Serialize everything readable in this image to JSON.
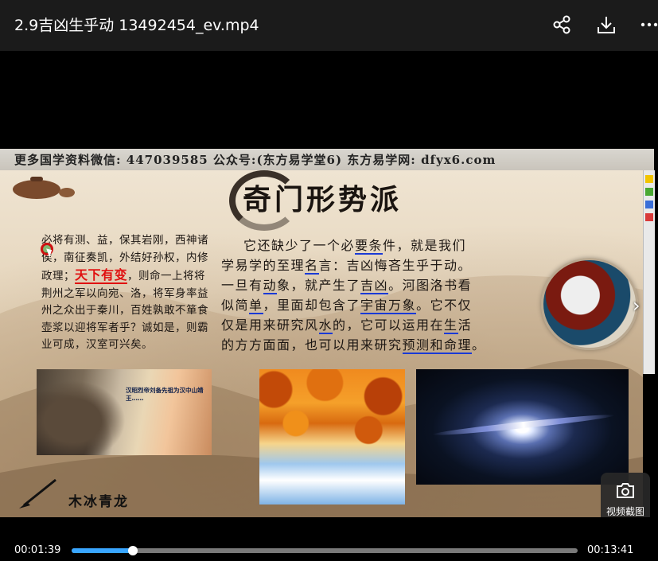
{
  "header": {
    "title": "2.9吉凶生乎动 13492454_ev.mp4",
    "icons": [
      "share-icon",
      "download-icon",
      "more-icon"
    ]
  },
  "slide": {
    "banner": "更多国学资料微信: 447039585 公众号:(东方易学堂6) 东方易学网: dfyx6.com",
    "title": "奇门形势派",
    "left_text_before": "必将有测、益，保其岩刚，西神诸侯，南征奏凯，外结好孙权，内修政理；",
    "left_highlight": "天下有变",
    "left_text_after": "，则命一上将将荆州之军以向宛、洛，将军身率益州之众出于秦川，百姓孰敢不箪食壶浆以迎将军者乎？诚如是，则霸业可成，汉室可兴矣。",
    "main_lines": [
      {
        "indent": true,
        "segments": [
          {
            "text": "它还缺少了一个必",
            "u": false
          },
          {
            "text": "要条",
            "u": true
          },
          {
            "text": "件，就是我们",
            "u": false
          }
        ]
      },
      {
        "indent": false,
        "segments": [
          {
            "text": "学易学的至理",
            "u": false
          },
          {
            "text": "名",
            "u": true
          },
          {
            "text": "言：吉凶悔吝生乎于动。",
            "u": false
          }
        ]
      },
      {
        "indent": false,
        "segments": [
          {
            "text": "一旦有",
            "u": false
          },
          {
            "text": "动",
            "u": true
          },
          {
            "text": "象，就产生了",
            "u": false
          },
          {
            "text": "吉凶",
            "u": true
          },
          {
            "text": "。河图洛书看",
            "u": false
          }
        ]
      },
      {
        "indent": false,
        "segments": [
          {
            "text": "似简",
            "u": false
          },
          {
            "text": "单",
            "u": true
          },
          {
            "text": "，里面却包含了",
            "u": false
          },
          {
            "text": "宇宙万象",
            "u": true
          },
          {
            "text": "。它不仅",
            "u": false
          }
        ]
      },
      {
        "indent": false,
        "segments": [
          {
            "text": "仅是用来研究风",
            "u": false
          },
          {
            "text": "水",
            "u": true
          },
          {
            "text": "的，它可以运用在",
            "u": false
          },
          {
            "text": "生",
            "u": true
          },
          {
            "text": "活",
            "u": false
          }
        ]
      },
      {
        "indent": false,
        "segments": [
          {
            "text": "的方方面面，也可以用来研究",
            "u": false
          },
          {
            "text": "预测和命理",
            "u": true
          },
          {
            "text": "。",
            "u": false
          }
        ]
      }
    ],
    "image1_caption": "汉昭烈帝刘备先祖为汉中山靖王……",
    "signature": "木冰青龙"
  },
  "player": {
    "current_time": "00:01:39",
    "total_time": "00:13:41",
    "progress": 0.1206,
    "snapshot_label": "视频截图"
  },
  "colors": {
    "progress_fill": "#39a6ff",
    "highlight_red": "#e01010",
    "underline_blue": "#1a3ad6"
  }
}
